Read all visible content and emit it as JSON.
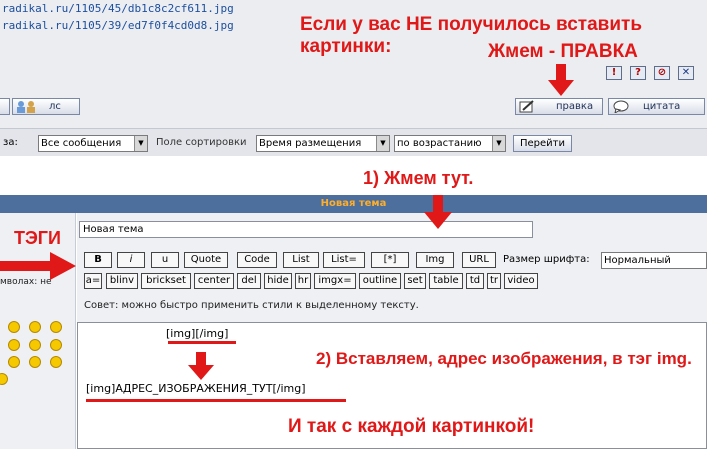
{
  "top": {
    "links": [
      "radikal.ru/1105/45/db1c8c2cf611.jpg",
      "radikal.ru/1105/39/ed7f0f4cd0d8.jpg"
    ],
    "annotation_line1": "Если у вас НЕ получилось вставить картинки:",
    "annotation_line2": "Жмем - ПРАВКА",
    "icons": [
      "!",
      "?",
      "⊘",
      "✕"
    ],
    "ls_button": "лс",
    "edit_button": "правка",
    "quote_button": "цитата"
  },
  "sortbar": {
    "label_show": "за:",
    "show_value": "Все сообщения",
    "sort_label": "Поле сортировки",
    "sort_value": "Время размещения",
    "order_value": "по возрастанию",
    "go_button": "Перейти"
  },
  "editor": {
    "step1_annotation": "1)  Жмем тут.",
    "header_title": "Новая тема",
    "title_value": "Новая тема",
    "tags_annotation": "ТЭГИ",
    "left_text": "мволах: не",
    "toolbar_row1": [
      "B",
      "i",
      "u",
      "Quote",
      "Code",
      "List",
      "List=",
      "[*]",
      "Img",
      "URL"
    ],
    "font_size_label": "Размер шрифта:",
    "font_size_value": "Нормальный",
    "toolbar_row2": [
      "a=",
      "blinv",
      "brickset",
      "center",
      "del",
      "hide",
      "hr",
      "imgx=",
      "outline",
      "set",
      "table",
      "td",
      "tr",
      "video"
    ],
    "tip": "Совет: можно быстро применить стили к выделенному тексту.",
    "img_tags": "[img][/img]",
    "step2_annotation": "2) Вставляем, адрес изображения, в тэг img.",
    "img_example": "[img]АДРЕС_ИЗОБРАЖЕНИЯ_ТУТ[/img]",
    "footer_annotation": "И так с каждой картинкой!"
  }
}
